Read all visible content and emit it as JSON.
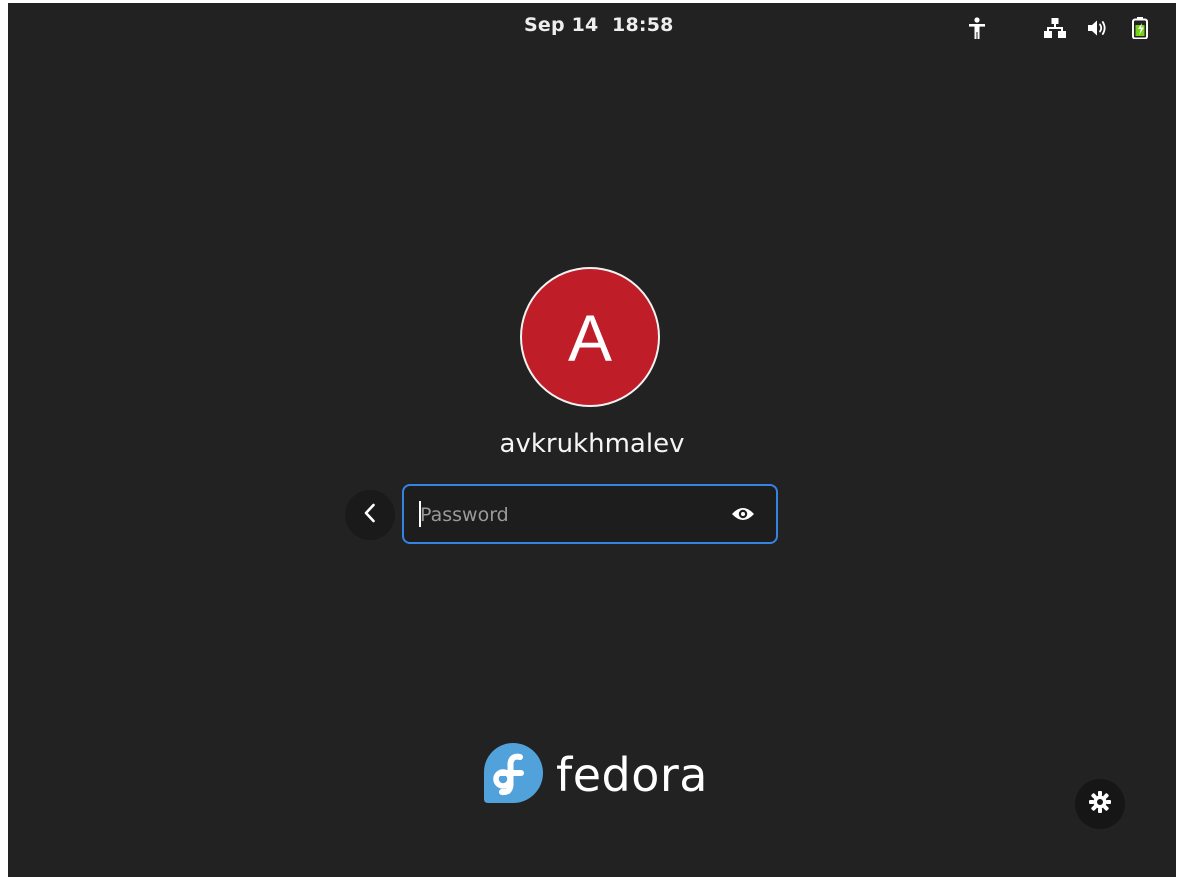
{
  "topbar": {
    "clock": "Sep 14  18:58",
    "icons": {
      "accessibility": "accessibility-icon",
      "network": "network-wired-icon",
      "volume": "volume-icon",
      "battery": "battery-charging-icon"
    }
  },
  "login": {
    "avatar_initial": "A",
    "avatar_color": "#bf1d28",
    "username": "avkrukhmalev",
    "password": {
      "placeholder": "Password",
      "value": ""
    },
    "back_icon": "chevron-left-icon",
    "reveal_icon": "eye-icon",
    "focus_color": "#3584e4"
  },
  "branding": {
    "logo_text": "fedora",
    "logo_icon": "fedora-logo-icon",
    "logo_color": "#51a2da"
  },
  "footer": {
    "settings_icon": "gear-icon"
  }
}
